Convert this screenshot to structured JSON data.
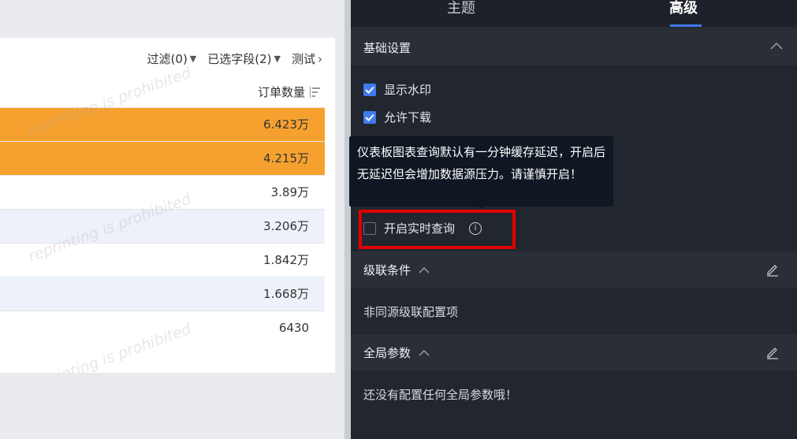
{
  "toolbar": {
    "filter_label": "过滤(0)",
    "fields_label": "已选字段(2)",
    "test_label": "测试"
  },
  "table": {
    "column_header": "订单数量",
    "rows": [
      "6.423万",
      "4.215万",
      "3.89万",
      "3.206万",
      "1.842万",
      "1.668万",
      "6430"
    ]
  },
  "watermark": "reprinting is prohibited",
  "panel": {
    "tabs": [
      "主题",
      "高级"
    ],
    "active_tab": "高级",
    "basic": {
      "title": "基础设置",
      "options": [
        {
          "label": "显示水印",
          "checked": true
        },
        {
          "label": "允许下载",
          "checked": true
        },
        {
          "label": "开启实时查询",
          "checked": false
        }
      ]
    },
    "tooltip": "仪表板图表查询默认有一分钟缓存延迟，开启后无延迟但会增加数据源压力。请谨慎开启！",
    "cascade": {
      "title": "级联条件",
      "body": "非同源级联配置项"
    },
    "global_params": {
      "title": "全局参数",
      "body": "还没有配置任何全局参数哦！"
    }
  },
  "colors": {
    "accent": "#3f7bf0",
    "highlight_row": "#f6a12f",
    "highlight_box": "#e00000",
    "panel_bg": "#22262f"
  }
}
